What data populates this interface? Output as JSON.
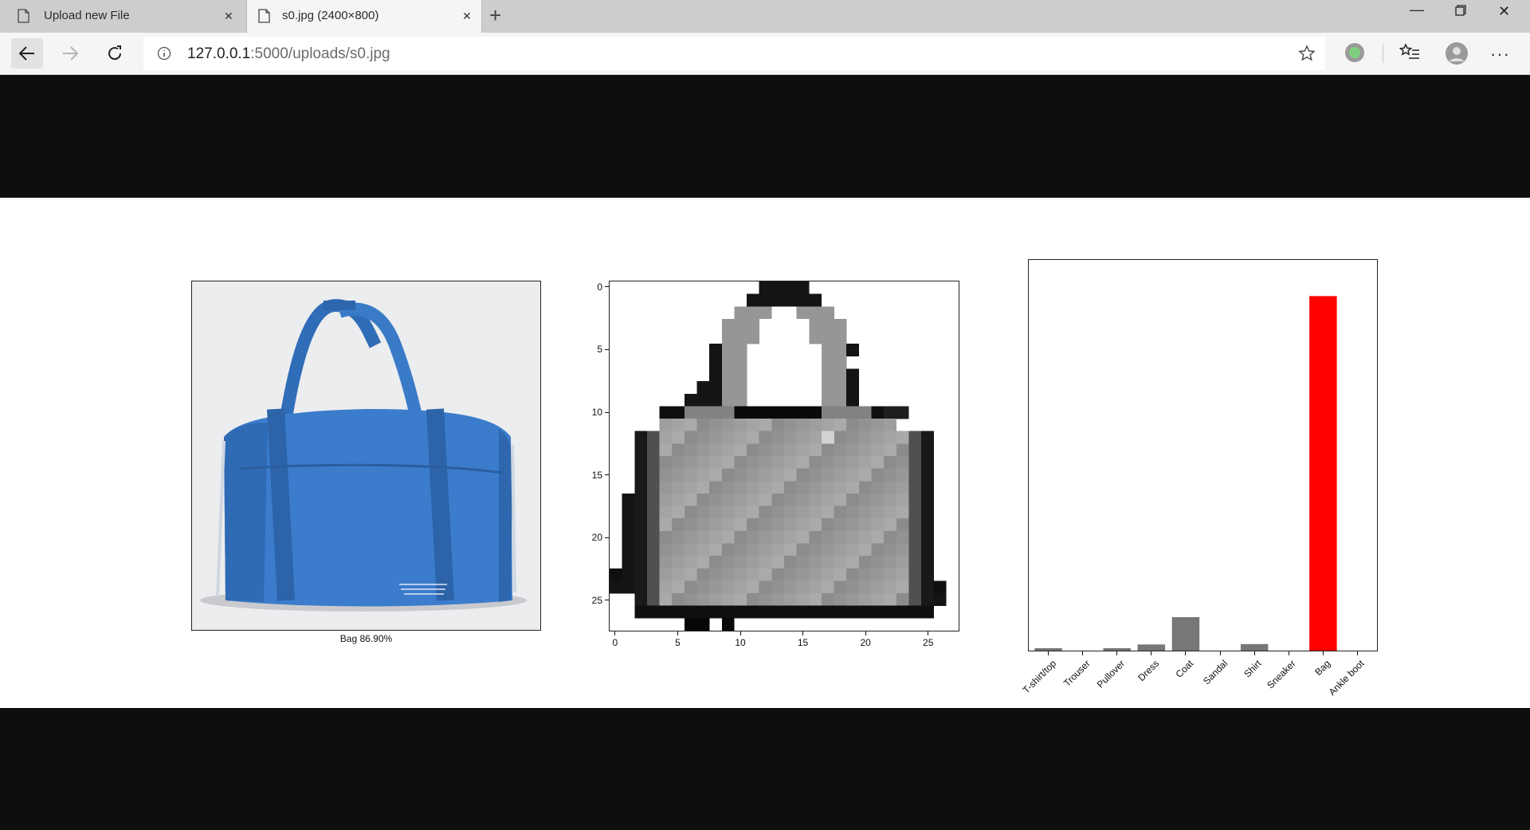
{
  "browser": {
    "tabs": [
      {
        "title": "Upload new File",
        "active": false
      },
      {
        "title": "s0.jpg (2400×800)",
        "active": true
      }
    ],
    "url_host": "127.0.0.1",
    "url_rest": ":5000/uploads/s0.jpg"
  },
  "image": {
    "caption": "Bag 86.90%",
    "pixel_axis": {
      "x_ticks": [
        "0",
        "5",
        "10",
        "15",
        "20",
        "25"
      ],
      "y_ticks": [
        "0",
        "5",
        "10",
        "15",
        "20",
        "25"
      ]
    }
  },
  "chart_data": {
    "type": "bar",
    "categories": [
      "T-shirt/top",
      "Trouser",
      "Pullover",
      "Dress",
      "Coat",
      "Sandal",
      "Shirt",
      "Sneaker",
      "Bag",
      "Ankle boot"
    ],
    "values": [
      0.006,
      0.0,
      0.006,
      0.015,
      0.082,
      0.0,
      0.016,
      0.0,
      0.869,
      0.0
    ],
    "highlight_index": 8,
    "highlight_color": "#ff0000",
    "bar_color": "#777777",
    "ylim": [
      0,
      1
    ]
  }
}
